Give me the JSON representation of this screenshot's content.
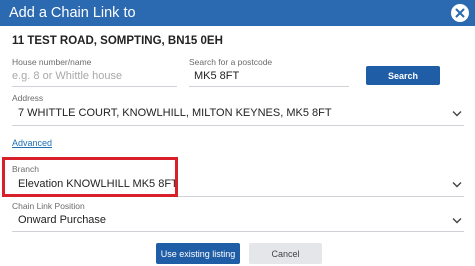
{
  "dialog": {
    "title": "Add a Chain Link to",
    "property_address": "11 TEST ROAD, SOMPTING, BN15 0EH"
  },
  "house": {
    "label": "House number/name",
    "placeholder": "e.g. 8 or Whittle house",
    "value": ""
  },
  "postcode": {
    "label": "Search for a postcode",
    "value": "MK5 8FT"
  },
  "search_button": "Search",
  "address": {
    "label": "Address",
    "value": "7 WHITTLE COURT, KNOWLHILL, MILTON KEYNES, MK5 8FT"
  },
  "advanced_link": "Advanced",
  "branch": {
    "label": "Branch",
    "value": "Elevation KNOWLHILL MK5 8FT"
  },
  "chain_position": {
    "label": "Chain Link Position",
    "value": "Onward Purchase"
  },
  "buttons": {
    "use_existing": "Use existing listing",
    "cancel": "Cancel"
  },
  "colors": {
    "header": "#2b69b0",
    "primary_button": "#1f5da6",
    "highlight": "#d8202a",
    "link": "#1f6fb4"
  },
  "icons": {
    "close": "close-circle-icon",
    "dropdown": "chevron-down-icon"
  }
}
